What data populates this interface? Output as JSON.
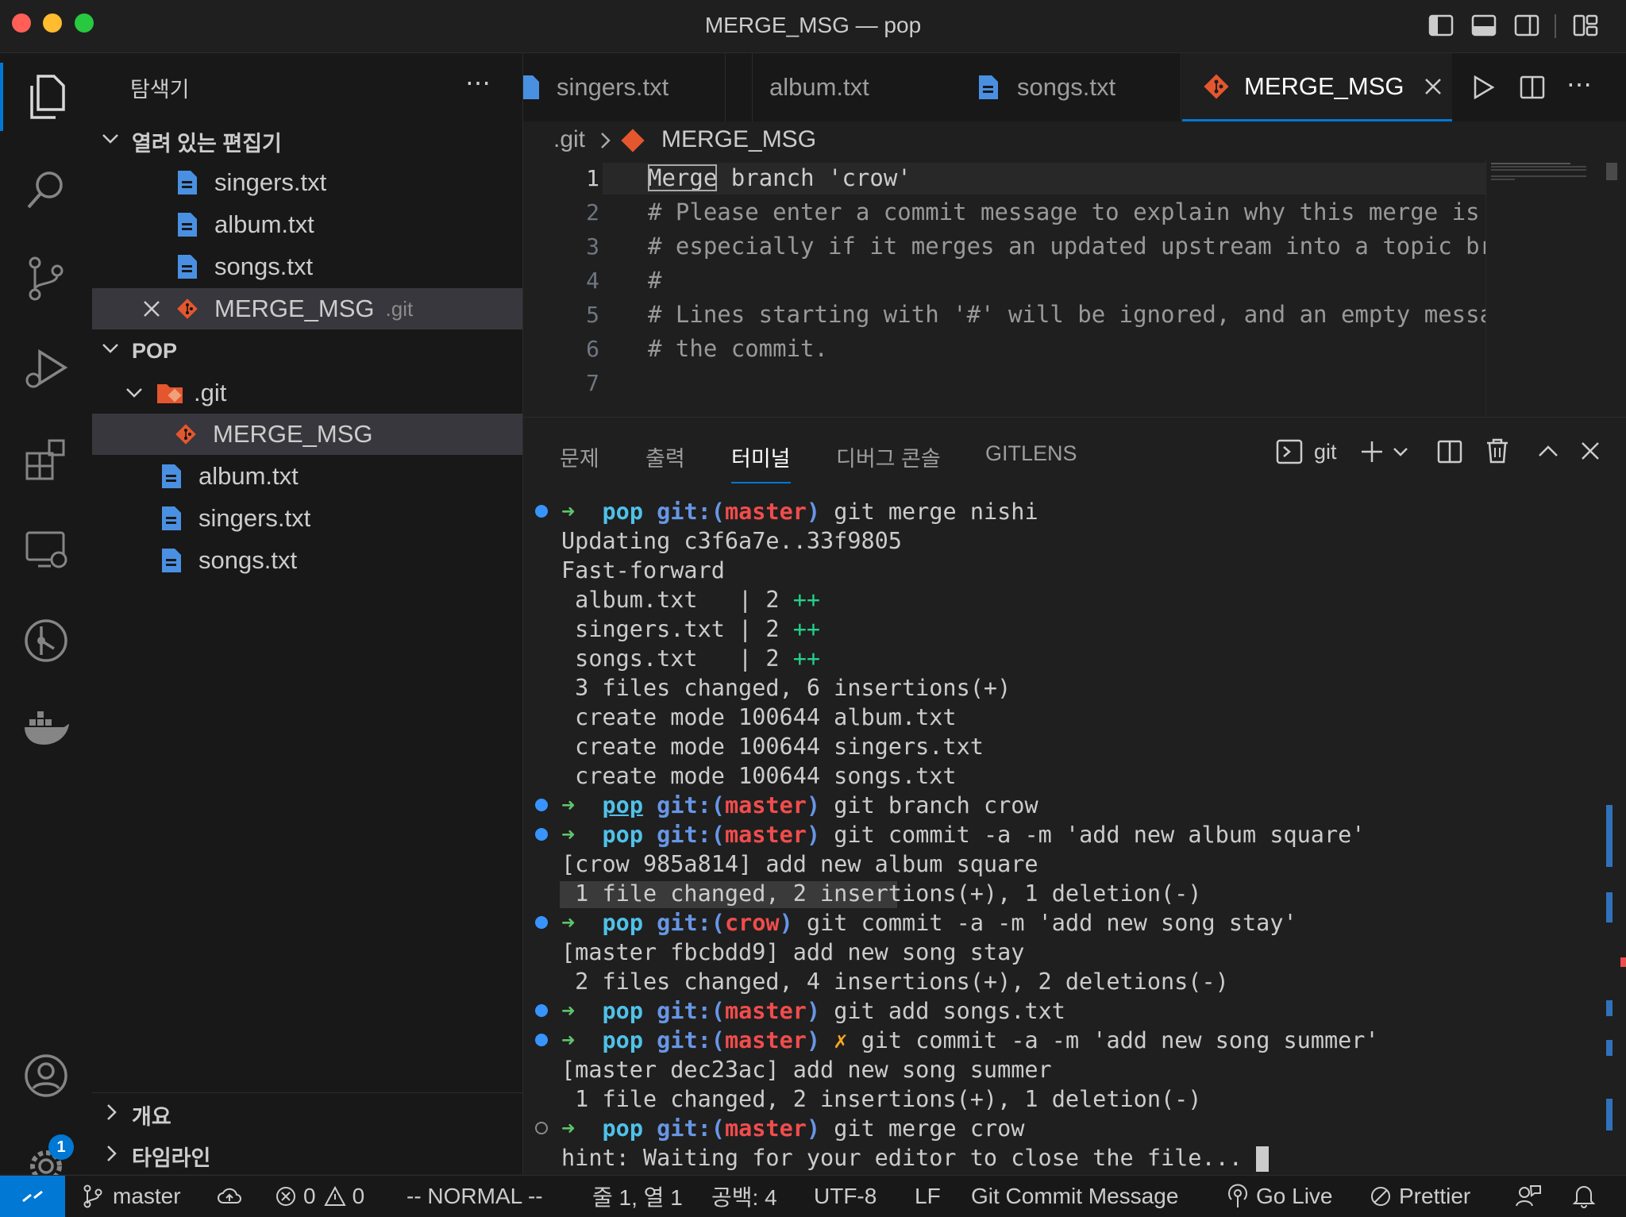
{
  "window": {
    "title": "MERGE_MSG — pop"
  },
  "explorer": {
    "title": "탐색기",
    "open_editors": {
      "header": "열려 있는 편집기",
      "items": [
        {
          "name": "singers.txt"
        },
        {
          "name": "album.txt"
        },
        {
          "name": "songs.txt"
        },
        {
          "name": "MERGE_MSG",
          "path": ".git"
        }
      ]
    },
    "folder": {
      "header": "POP",
      "git_folder": ".git",
      "git_child": "MERGE_MSG",
      "files": [
        "album.txt",
        "singers.txt",
        "songs.txt"
      ]
    },
    "outline": "개요",
    "timeline": "타임라인"
  },
  "tabs": [
    {
      "label": "singers.txt"
    },
    {
      "label": "album.txt"
    },
    {
      "label": "songs.txt"
    },
    {
      "label": "MERGE_MSG"
    }
  ],
  "breadcrumb": {
    "folder": ".git",
    "file": "MERGE_MSG"
  },
  "editor": {
    "lines": [
      {
        "n": "1",
        "first_word": "Merge",
        "rest": " branch 'crow'"
      },
      {
        "n": "2",
        "text": "# Please enter a commit message to explain why this merge is"
      },
      {
        "n": "3",
        "text": "# especially if it merges an updated upstream into a topic br"
      },
      {
        "n": "4",
        "text": "#"
      },
      {
        "n": "5",
        "text": "# Lines starting with '#' will be ignored, and an empty messa"
      },
      {
        "n": "6",
        "text": "# the commit."
      },
      {
        "n": "7",
        "text": ""
      }
    ]
  },
  "panel": {
    "tabs": [
      "문제",
      "출력",
      "터미널",
      "디버그 콘솔",
      "GITLENS"
    ],
    "terminal_name": "git"
  },
  "terminal": {
    "prompt_dir": "pop",
    "git_label": "git:(",
    "close_paren": ")",
    "arrow": "➜",
    "dirty": "✗",
    "cmd1": {
      "branch": "master",
      "cmd": "git merge nishi"
    },
    "out1": [
      "Updating c3f6a7e..33f9805",
      "Fast-forward",
      " album.txt   | 2 ",
      " singers.txt | 2 ",
      " songs.txt   | 2 ",
      " 3 files changed, 6 insertions(+)",
      " create mode 100644 album.txt",
      " create mode 100644 singers.txt",
      " create mode 100644 songs.txt"
    ],
    "plus": "++",
    "cmd2": {
      "branch": "master",
      "cmd": "git branch crow"
    },
    "cmd3": {
      "branch": "master",
      "cmd": "git commit -a -m 'add new album square'"
    },
    "out3": [
      "[crow 985a814] add new album square",
      " 1 file changed, 2 insertions(+), 1 deletion(-)"
    ],
    "cmd4": {
      "branch": "crow",
      "cmd": "git commit -a -m 'add new song stay'"
    },
    "out4": [
      "[master fbcbdd9] add new song stay",
      " 2 files changed, 4 insertions(+), 2 deletions(-)"
    ],
    "cmd5": {
      "branch": "master",
      "cmd": "git add songs.txt"
    },
    "cmd6": {
      "branch": "master",
      "cmd": "git commit -a -m 'add new song summer'"
    },
    "out6": [
      "[master dec23ac] add new song summer",
      " 1 file changed, 2 insertions(+), 1 deletion(-)"
    ],
    "cmd7": {
      "branch": "master",
      "cmd": "git merge crow"
    },
    "out7": "hint: Waiting for your editor to close the file... "
  },
  "statusbar": {
    "branch": "master",
    "errors": "0",
    "warnings": "0",
    "mode": "-- NORMAL --",
    "position": "줄 1, 열 1",
    "spaces": "공백: 4",
    "encoding": "UTF-8",
    "eol": "LF",
    "language": "Git Commit Message",
    "golive": "Go Live",
    "prettier": "Prettier"
  },
  "badges": {
    "settings": "1"
  },
  "colors": {
    "accent": "#0078d4",
    "git_orange": "#e4572e",
    "file_blue": "#519aba"
  }
}
